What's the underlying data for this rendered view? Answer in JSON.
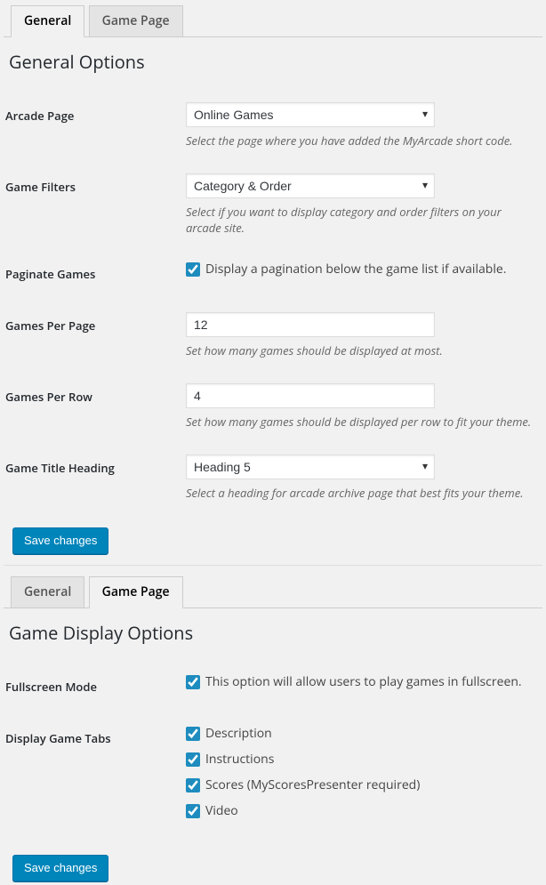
{
  "panel1": {
    "tabs": {
      "general": "General",
      "gamePage": "Game Page"
    },
    "heading": "General Options",
    "rows": {
      "arcadePage": {
        "label": "Arcade Page",
        "value": "Online Games",
        "desc": "Select the page where you have added the MyArcade short code."
      },
      "gameFilters": {
        "label": "Game Filters",
        "value": "Category & Order",
        "desc": "Select if you want to display category and order filters on your arcade site."
      },
      "paginate": {
        "label": "Paginate Games",
        "checkLabel": "Display a pagination below the game list if available."
      },
      "gamesPerPage": {
        "label": "Games Per Page",
        "value": "12",
        "desc": "Set how many games should be displayed at most."
      },
      "gamesPerRow": {
        "label": "Games Per Row",
        "value": "4",
        "desc": "Set how many games should be displayed per row to fit your theme."
      },
      "titleHeading": {
        "label": "Game Title Heading",
        "value": "Heading 5",
        "desc": "Select a heading for arcade archive page that best fits your theme."
      }
    },
    "saveLabel": "Save changes"
  },
  "panel2": {
    "tabs": {
      "general": "General",
      "gamePage": "Game Page"
    },
    "heading": "Game Display Options",
    "fullscreen": {
      "label": "Fullscreen Mode",
      "checkLabel": "This option will allow users to play games in fullscreen."
    },
    "displayTabs": {
      "label": "Display Game Tabs",
      "items": {
        "description": "Description",
        "instructions": "Instructions",
        "scores": "Scores (MyScoresPresenter required)",
        "video": "Video"
      }
    },
    "saveLabel": "Save changes"
  }
}
